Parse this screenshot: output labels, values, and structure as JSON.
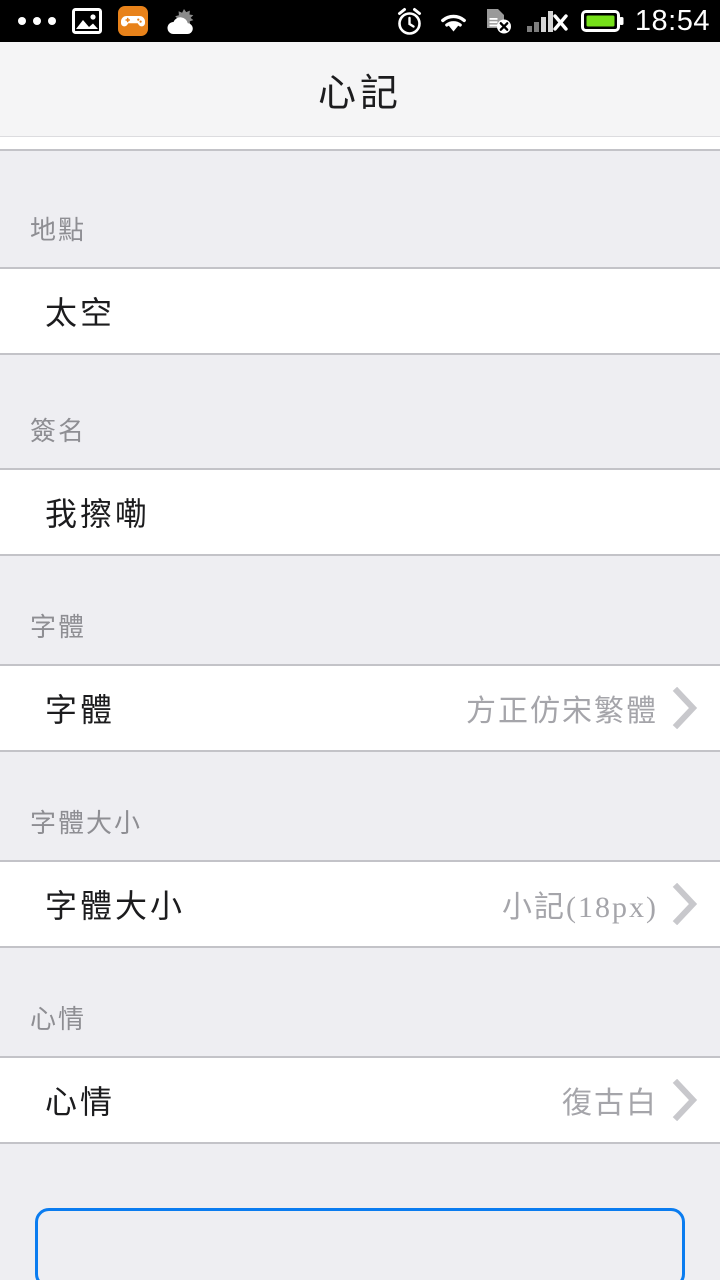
{
  "statusbar": {
    "time": "18:54",
    "left_icons": [
      "more-dots-icon",
      "photo-icon",
      "game-app-icon",
      "weather-cloud-icon"
    ],
    "right_icons": [
      "alarm-icon",
      "wifi-icon",
      "sim-card-off-icon",
      "signal-off-icon",
      "battery-icon"
    ],
    "battery_color": "#76e01a",
    "background": "#000000"
  },
  "titlebar": {
    "title": "心記"
  },
  "sections": [
    {
      "header": "地點",
      "row": {
        "label": "太空",
        "value": "",
        "has_chevron": false
      }
    },
    {
      "header": "簽名",
      "row": {
        "label": "我擦嘞",
        "value": "",
        "has_chevron": false
      }
    },
    {
      "header": "字體",
      "row": {
        "label": "字體",
        "value": "方正仿宋繁體",
        "has_chevron": true
      }
    },
    {
      "header": "字體大小",
      "row": {
        "label": "字體大小",
        "value": "小記(18px)",
        "has_chevron": true
      }
    },
    {
      "header": "心情",
      "row": {
        "label": "心情",
        "value": "復古白",
        "has_chevron": true
      }
    }
  ],
  "bottom": {
    "save_label": "",
    "accent_color": "#0a7cf0"
  },
  "colors": {
    "page_background": "#eeeef2",
    "row_background": "#ffffff",
    "divider": "#c3c3c8",
    "header_text": "#8e8e93",
    "value_text": "#a5a5aa",
    "label_text": "#1c1c1e",
    "chevron": "#c8c8cc",
    "titlebar_background": "#f5f5f6"
  }
}
